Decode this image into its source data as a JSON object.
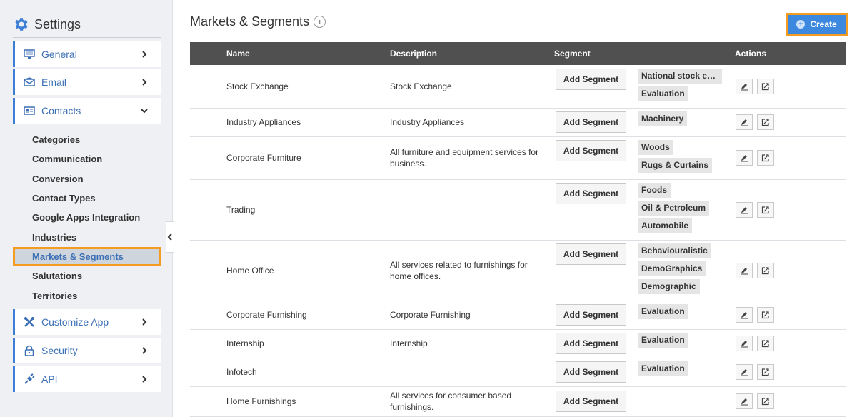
{
  "sidebar": {
    "title": "Settings",
    "items_top": [
      {
        "label": "General"
      },
      {
        "label": "Email"
      },
      {
        "label": "Contacts"
      }
    ],
    "contacts_sub": [
      {
        "label": "Categories"
      },
      {
        "label": "Communication"
      },
      {
        "label": "Conversion"
      },
      {
        "label": "Contact Types"
      },
      {
        "label": "Google Apps Integration"
      },
      {
        "label": "Industries"
      },
      {
        "label": "Markets & Segments"
      },
      {
        "label": "Salutations"
      },
      {
        "label": "Territories"
      }
    ],
    "items_bottom": [
      {
        "label": "Customize App"
      },
      {
        "label": "Security"
      },
      {
        "label": "API"
      }
    ]
  },
  "main": {
    "title": "Markets & Segments",
    "create_label": "Create",
    "columns": {
      "name": "Name",
      "description": "Description",
      "segment": "Segment",
      "actions": "Actions"
    },
    "add_segment_label": "Add Segment",
    "rows": [
      {
        "name": "Stock Exchange",
        "description": "Stock Exchange",
        "tags": [
          "National stock exchange",
          "Evaluation"
        ]
      },
      {
        "name": "Industry Appliances",
        "description": "Industry Appliances",
        "tags": [
          "Machinery"
        ]
      },
      {
        "name": "Corporate Furniture",
        "description": "All furniture and equipment services for business.",
        "tags": [
          "Woods",
          "Rugs & Curtains"
        ]
      },
      {
        "name": "Trading",
        "description": "",
        "tags": [
          "Foods",
          "Oil & Petroleum",
          "Automobile"
        ]
      },
      {
        "name": "Home Office",
        "description": "All services related to furnishings for home offices.",
        "tags": [
          "Behaviouralistic",
          "DemoGraphics",
          "Demographic"
        ]
      },
      {
        "name": "Corporate Furnishing",
        "description": "Corporate Furnishing",
        "tags": [
          "Evaluation"
        ]
      },
      {
        "name": "Internship",
        "description": "Internship",
        "tags": [
          "Evaluation"
        ]
      },
      {
        "name": "Infotech",
        "description": "",
        "tags": [
          "Evaluation"
        ]
      },
      {
        "name": "Home Furnishings",
        "description": "All services for consumer based furnishings.",
        "tags": []
      }
    ]
  },
  "colors": {
    "accent": "#3d7fd6",
    "highlight": "#f39c1f",
    "header_bg": "#505050"
  }
}
